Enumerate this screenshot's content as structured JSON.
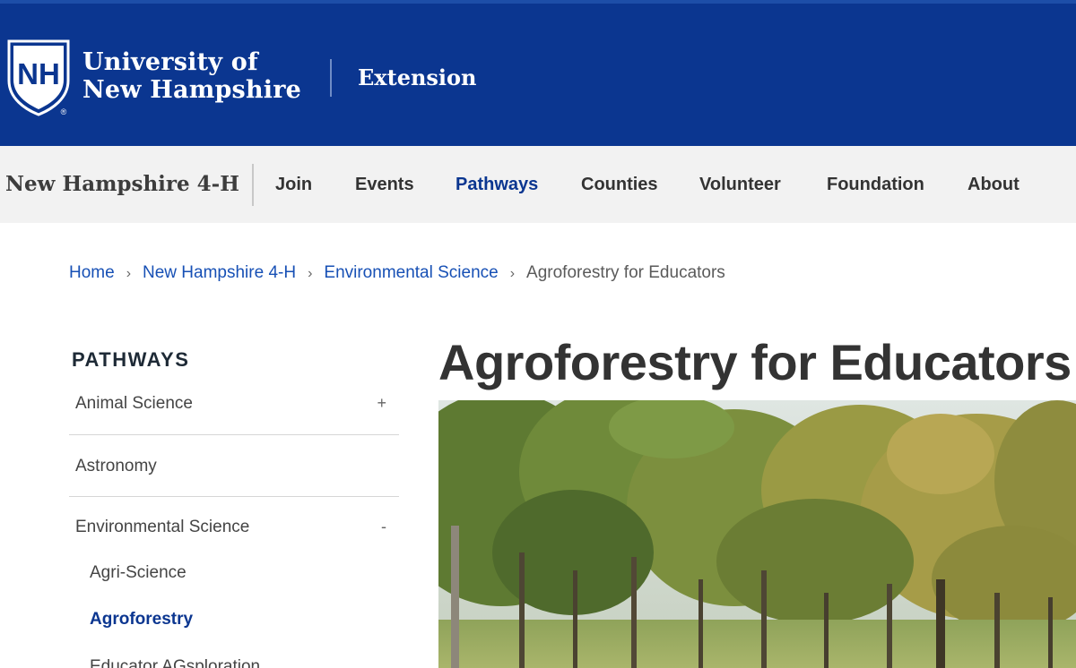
{
  "header": {
    "university_line1": "University of",
    "university_line2": "New Hampshire",
    "logo_letters": "NH",
    "registered_mark": "®",
    "extension_label": "Extension",
    "brand_color": "#0b3690"
  },
  "subnav": {
    "site_title": "New Hampshire 4-H",
    "links": [
      {
        "label": "Join"
      },
      {
        "label": "Events"
      },
      {
        "label": "Pathways",
        "active": true
      },
      {
        "label": "Counties"
      },
      {
        "label": "Volunteer"
      },
      {
        "label": "Foundation"
      },
      {
        "label": "About"
      }
    ]
  },
  "breadcrumb": {
    "items": [
      "Home",
      "New Hampshire 4-H",
      "Environmental Science"
    ],
    "current": "Agroforestry for Educators",
    "separator": "›"
  },
  "sidebar": {
    "heading": "PATHWAYS",
    "items": [
      {
        "label": "Animal Science",
        "toggle": "+"
      },
      {
        "label": "Astronomy",
        "toggle": ""
      },
      {
        "label": "Environmental Science",
        "toggle": "-"
      }
    ],
    "subitems": [
      {
        "label": "Agri-Science"
      },
      {
        "label": "Agroforestry",
        "active": true
      },
      {
        "label": "Educator AGsploration"
      }
    ]
  },
  "main": {
    "title": "Agroforestry for Educators",
    "hero_image": "agroforestry-trees-photo"
  }
}
